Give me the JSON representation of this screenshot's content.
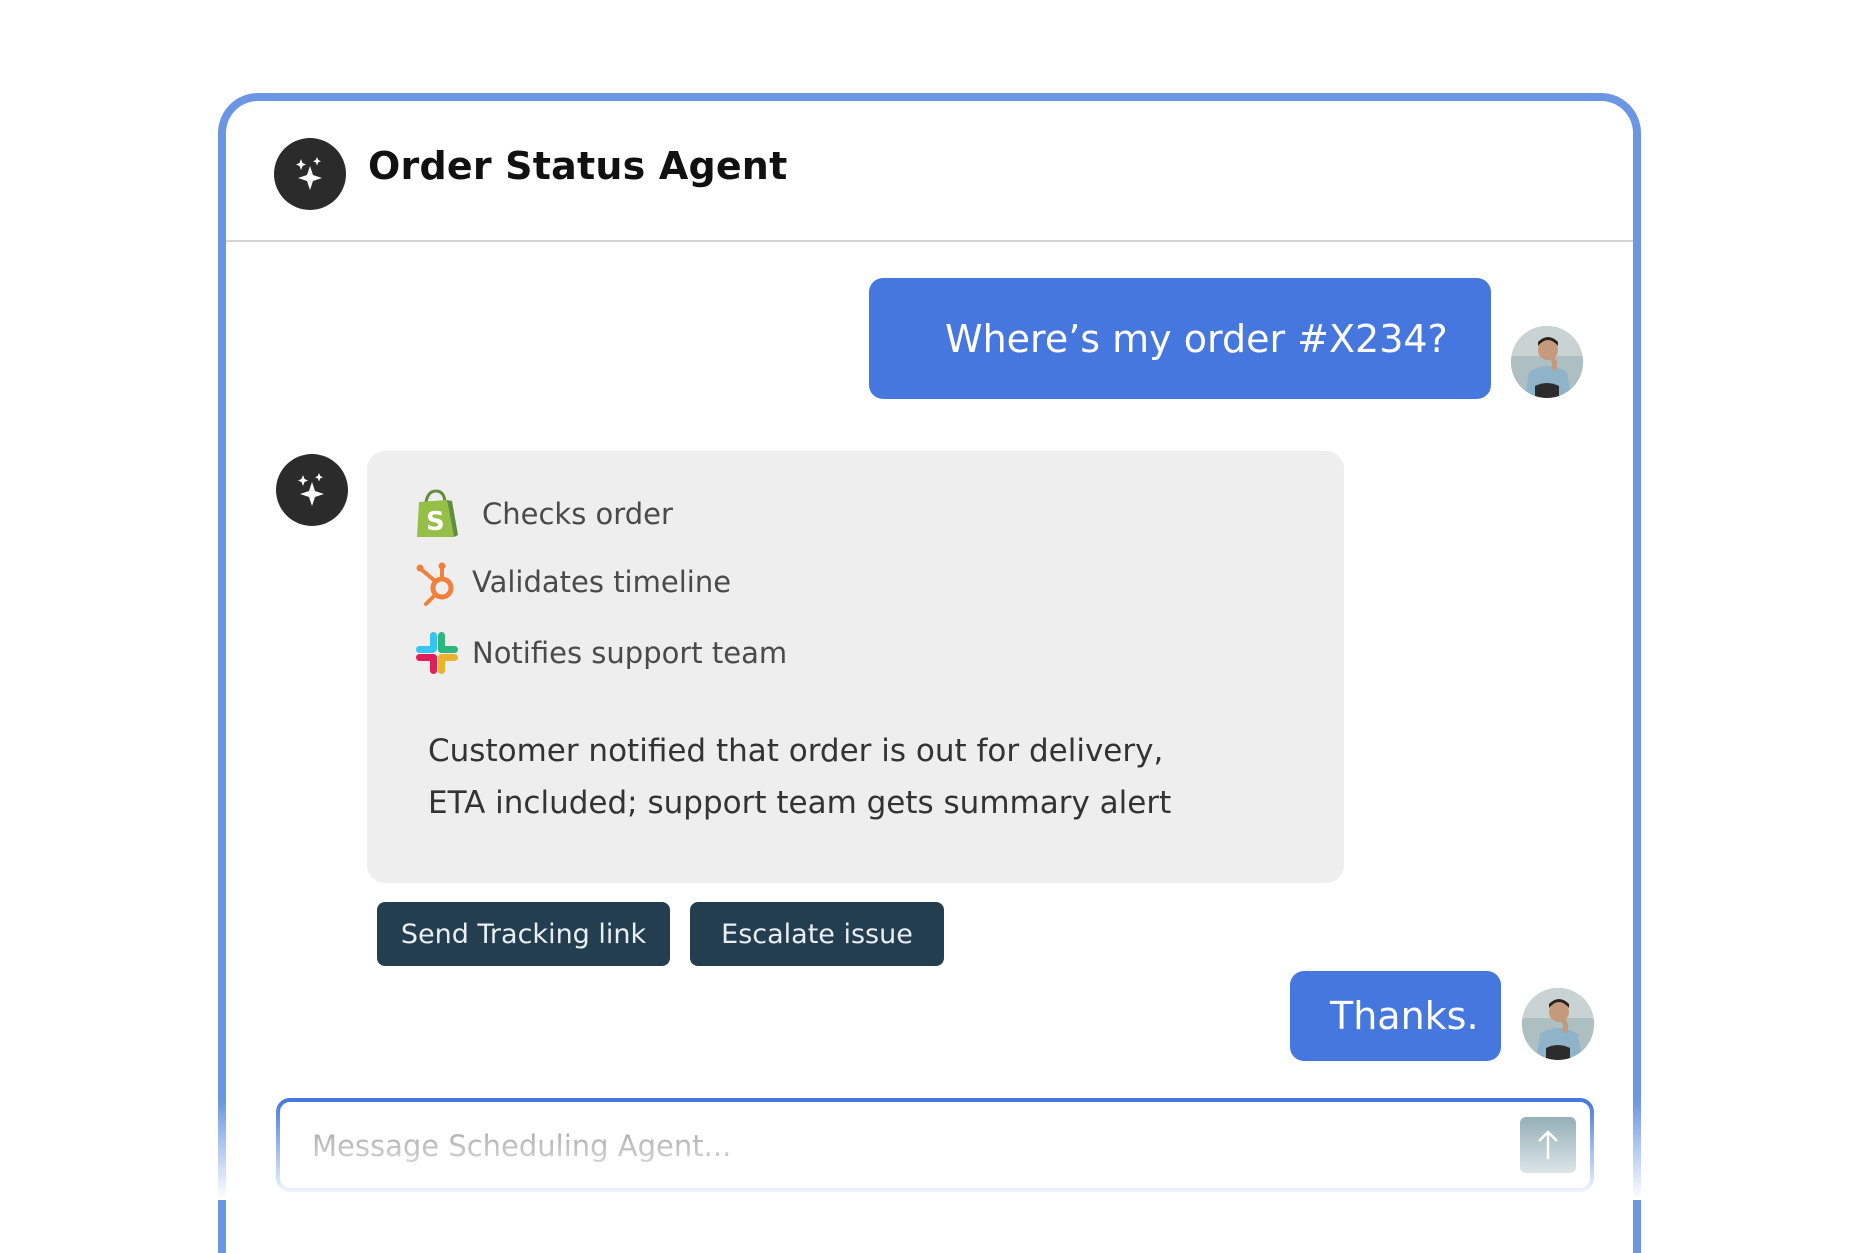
{
  "header": {
    "title": "Order Status Agent",
    "agent_icon": "sparkles-icon"
  },
  "messages": [
    {
      "role": "user",
      "text": "Where’s my order #X234?"
    },
    {
      "role": "agent",
      "steps": [
        {
          "icon": "shopify-icon",
          "label": "Checks order"
        },
        {
          "icon": "hubspot-icon",
          "label": "Validates timeline"
        },
        {
          "icon": "slack-icon",
          "label": "Notifies support team"
        }
      ],
      "summary_lines": [
        "Customer notified that order is out for delivery,",
        "ETA included; support team gets summary alert"
      ],
      "actions": [
        "Send Tracking link",
        "Escalate issue"
      ]
    },
    {
      "role": "user",
      "text": "Thanks."
    }
  ],
  "composer": {
    "placeholder": "Message Scheduling Agent...",
    "send_icon": "arrow-up-icon"
  },
  "colors": {
    "accent": "#4677df",
    "frame_border": "#6b96e3",
    "agent_card_bg": "#efeeef",
    "action_button_bg": "#233e4e",
    "send_button_bg": "#7f9faa"
  }
}
